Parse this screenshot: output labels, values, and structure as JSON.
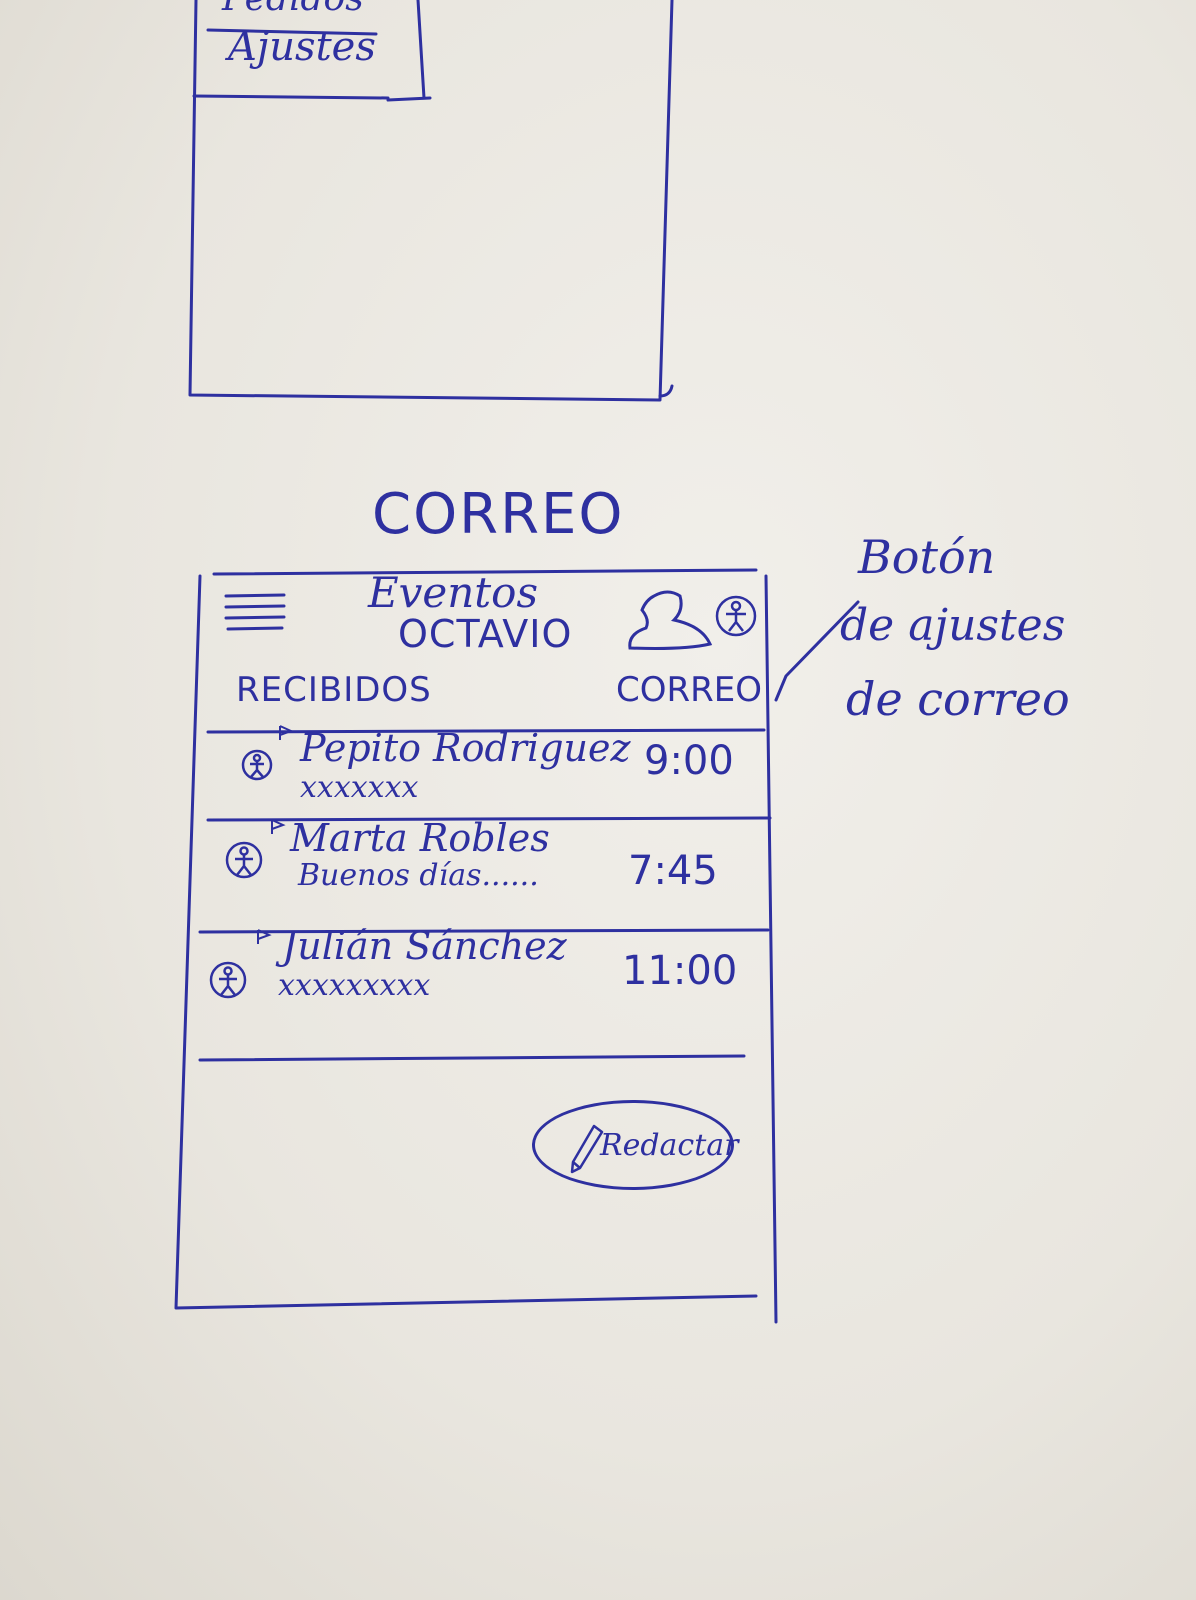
{
  "top_frame": {
    "previous_item_partial": "Pedidos",
    "settings_item": "Ajustes"
  },
  "section_title": "CORREO",
  "header": {
    "title_line1": "Eventos",
    "title_line2": "OCTAVIO"
  },
  "folder_bar": {
    "folder_label": "RECIBIDOS",
    "mail_label": "CORREO"
  },
  "messages": [
    {
      "sender": "Pepito Rodriguez",
      "preview": "xxxxxxx",
      "time": "9:00"
    },
    {
      "sender": "Marta Robles",
      "preview": "Buenos días......",
      "time": "7:45"
    },
    {
      "sender": "Julián Sánchez",
      "preview": "xxxxxxxxx",
      "time": "11:00"
    }
  ],
  "compose": {
    "label": "Redactar"
  },
  "annotation": {
    "line1": "Botón",
    "line2": "de ajustes",
    "line3": "de correo"
  },
  "colors": {
    "ink": "#2e30a0",
    "paper": "#ecead f"
  }
}
